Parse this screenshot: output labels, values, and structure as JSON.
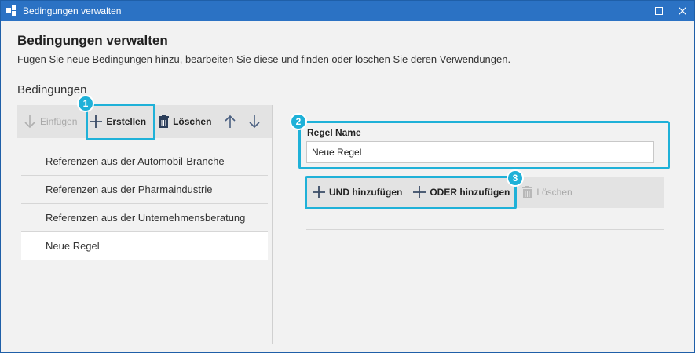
{
  "window": {
    "title": "Bedingungen verwalten"
  },
  "header": {
    "title": "Bedingungen verwalten",
    "description": "Fügen Sie neue Bedingungen hinzu, bearbeiten Sie diese und finden oder löschen Sie deren Verwendungen."
  },
  "conditions": {
    "section_label": "Bedingungen",
    "toolbar": {
      "insert_label": "Einfügen",
      "create_label": "Erstellen",
      "delete_label": "Löschen"
    },
    "items": [
      {
        "label": "Referenzen aus der Automobil-Branche"
      },
      {
        "label": "Referenzen aus der Pharmaindustrie"
      },
      {
        "label": "Referenzen aus der Unternehmensberatung"
      },
      {
        "label": "Neue Regel",
        "selected": true
      }
    ]
  },
  "rule": {
    "name_label": "Regel Name",
    "name_value": "Neue Regel",
    "toolbar": {
      "add_and_label": "UND hinzufügen",
      "add_or_label": "ODER hinzufügen",
      "delete_label": "Löschen"
    }
  },
  "callouts": [
    {
      "number": "1"
    },
    {
      "number": "2"
    },
    {
      "number": "3"
    }
  ],
  "colors": {
    "titlebar": "#2b72c4",
    "callout": "#1fb1d8",
    "panel_bg": "#f2f2f2",
    "toolbar_bg": "#e3e3e3"
  }
}
